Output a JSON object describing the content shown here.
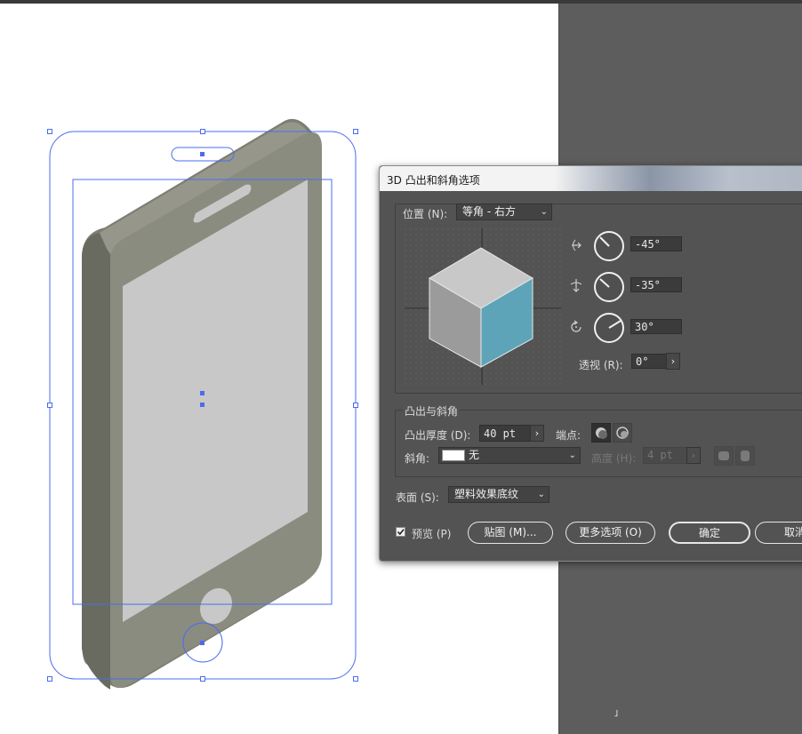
{
  "dialog": {
    "title": "3D 凸出和斜角选项",
    "position": {
      "label": "位置 (N):",
      "preset_value": "等角 - 右方",
      "rotation_x": "-45°",
      "rotation_y": "-35°",
      "rotation_z": "30°",
      "perspective_label": "透视 (R):",
      "perspective_value": "0°"
    },
    "extrude": {
      "section_label": "凸出与斜角",
      "depth_label": "凸出厚度 (D):",
      "depth_value": "40 pt",
      "cap_label": "端点:",
      "bevel_label": "斜角:",
      "bevel_value": "无",
      "height_label": "高度 (H):",
      "height_value": "4 pt"
    },
    "surface": {
      "label": "表面 (S):",
      "value": "塑料效果底纹"
    },
    "footer": {
      "preview_label": "预览 (P)",
      "preview_checked": true,
      "map_button": "贴图 (M)...",
      "more_options_button": "更多选项 (O)",
      "ok_button": "确定",
      "cancel_button": "取消"
    },
    "colors": {
      "cube_top": "#c8c8c8",
      "cube_left": "#9b9b9b",
      "cube_right": "#5ea4b8"
    }
  },
  "canvas": {
    "selection_color": "#4a6cf0",
    "phone_body_color": "#8a8b7e",
    "screen_color": "#c8c8c8"
  }
}
